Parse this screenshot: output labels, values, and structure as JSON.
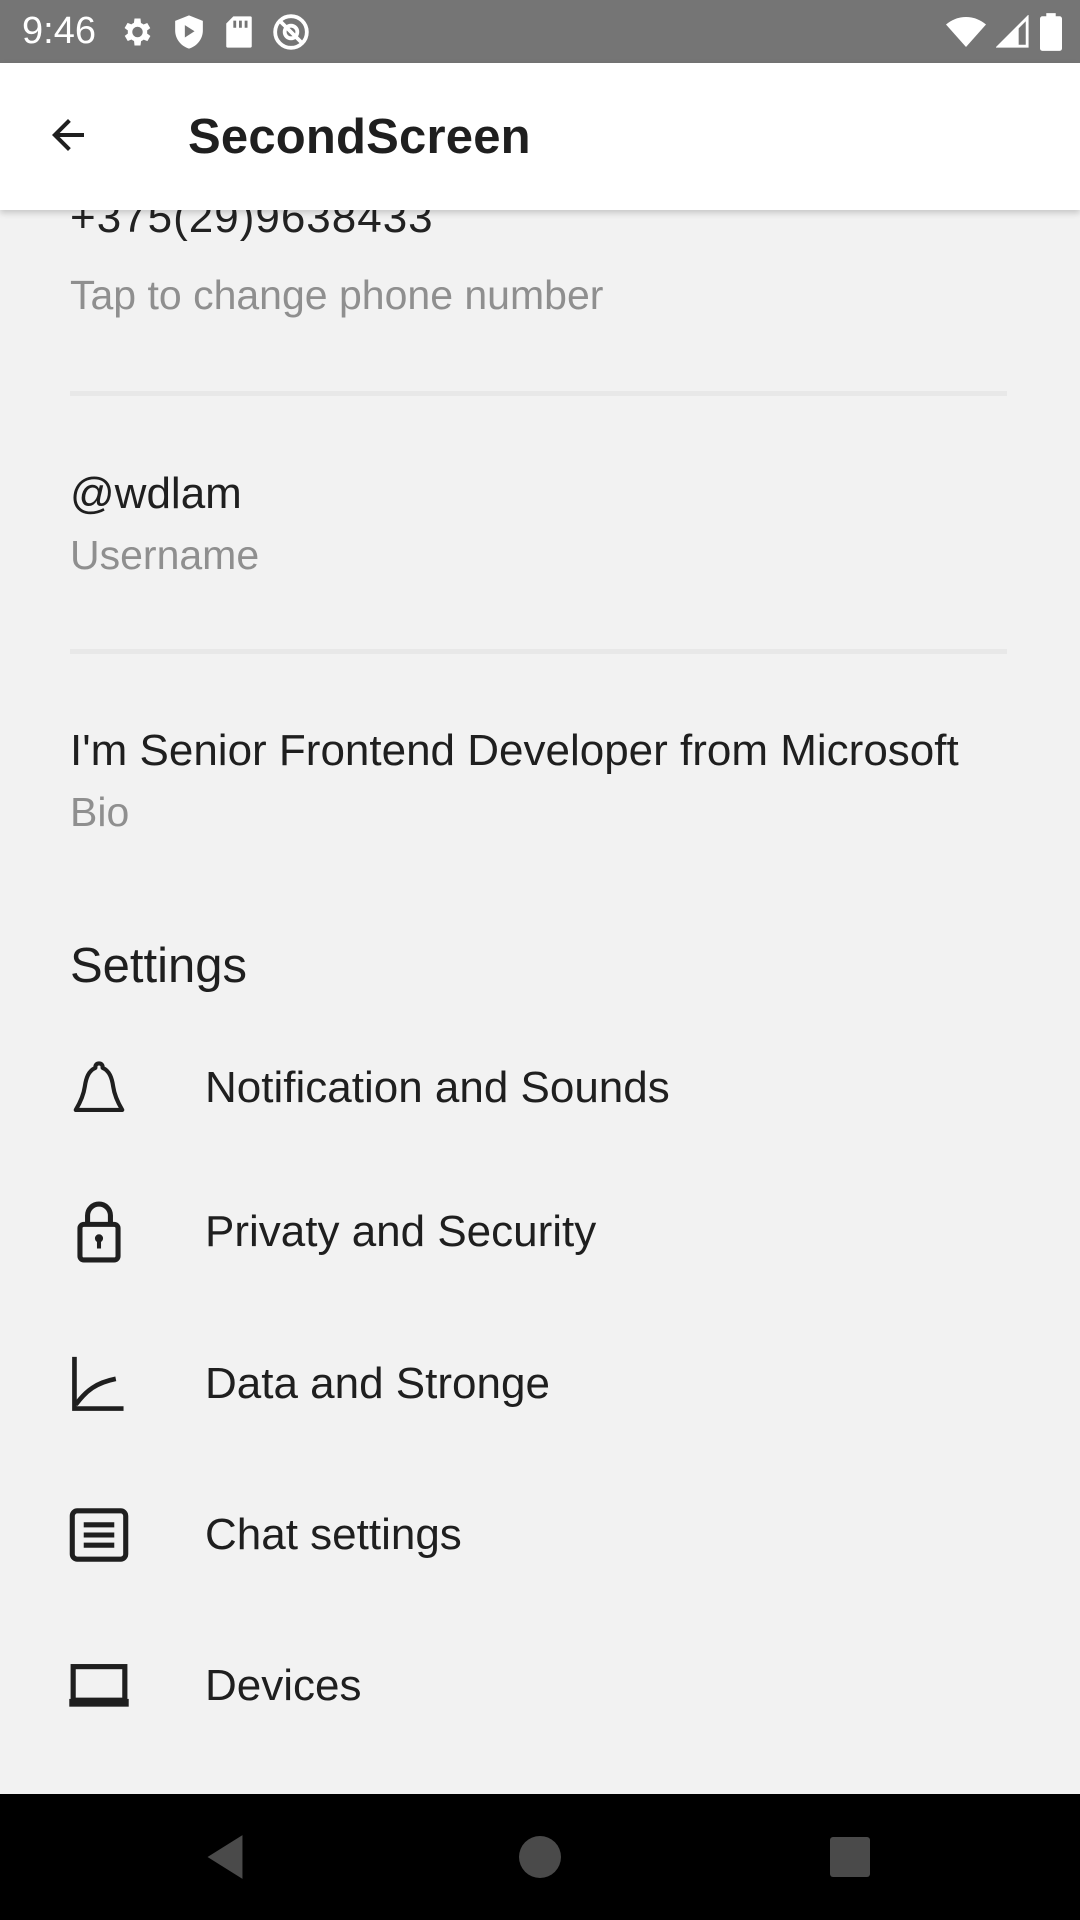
{
  "status_bar": {
    "time": "9:46",
    "left_icons": [
      "gear-icon",
      "shield-play-icon",
      "sd-card-icon",
      "at-sign-icon"
    ],
    "right_icons": [
      "wifi-icon",
      "signal-icon",
      "battery-icon"
    ]
  },
  "app_bar": {
    "title": "SecondScreen",
    "back_icon": "arrow-left-icon"
  },
  "profile": {
    "phone": "+375(29)9638433",
    "phone_hint": "Tap to change phone number",
    "username": "@wdlam",
    "username_caption": "Username",
    "bio": "I'm Senior Frontend Developer from Microsoft",
    "bio_caption": "Bio"
  },
  "settings": {
    "title": "Settings",
    "items": [
      {
        "label": "Notification and Sounds",
        "icon": "bell-icon"
      },
      {
        "label": "Privaty and Security",
        "icon": "lock-icon"
      },
      {
        "label": "Data and Stronge",
        "icon": "chart-icon"
      },
      {
        "label": "Chat settings",
        "icon": "chat-lines-icon"
      },
      {
        "label": "Devices",
        "icon": "laptop-icon"
      }
    ]
  },
  "nav_bar": {
    "buttons": [
      "back-triangle-icon",
      "home-circle-icon",
      "recents-square-icon"
    ]
  },
  "colors": {
    "status_bar": "#757575",
    "app_bar": "#ffffff",
    "background": "#f2f2f2",
    "secondary_text": "#8f8f8f",
    "nav_bar": "#000000"
  }
}
